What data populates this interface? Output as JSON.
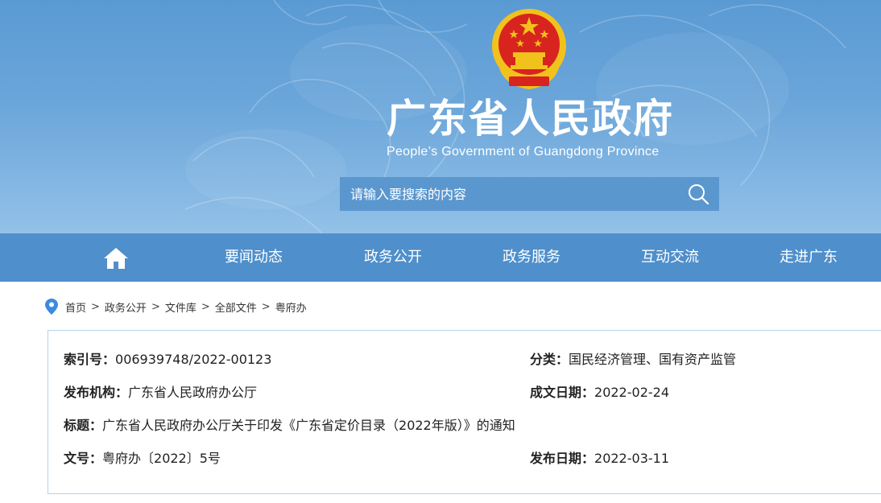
{
  "header": {
    "title": "广东省人民政府",
    "subtitle": "People’s Government of Guangdong Province",
    "emblem_icon": "national-emblem-icon"
  },
  "search": {
    "placeholder": "请输入要搜索的内容",
    "icon": "search-icon"
  },
  "nav": {
    "home_icon": "home-icon",
    "items": [
      {
        "label": "要闻动态"
      },
      {
        "label": "政务公开"
      },
      {
        "label": "政务服务"
      },
      {
        "label": "互动交流"
      },
      {
        "label": "走进广东"
      }
    ]
  },
  "breadcrumb": {
    "icon": "location-pin-icon",
    "separator": ">",
    "items": [
      "首页",
      "政务公开",
      "文件库",
      "全部文件",
      "粤府办"
    ]
  },
  "document_info": {
    "index_label": "索引号：",
    "index_value": "006939748/2022-00123",
    "category_label": "分类：",
    "category_value": "国民经济管理、国有资产监管",
    "publisher_label": "发布机构：",
    "publisher_value": "广东省人民政府办公厅",
    "created_label": "成文日期：",
    "created_value": "2022-02-24",
    "title_label": "标题：",
    "title_value": "广东省人民政府办公厅关于印发《广东省定价目录（2022年版）》的通知",
    "docno_label": "文号：",
    "docno_value": "粤府办〔2022〕5号",
    "published_label": "发布日期：",
    "published_value": "2022-03-11"
  },
  "colors": {
    "banner_top": "#5a9ad3",
    "banner_bottom": "#93c1e8",
    "nav_bar": "#4f8fcb",
    "search_box": "#5b97cf",
    "emblem_red": "#d8241f",
    "emblem_gold": "#f2c21c",
    "info_border": "#b8d2ec",
    "pin_blue": "#3b8be0"
  }
}
